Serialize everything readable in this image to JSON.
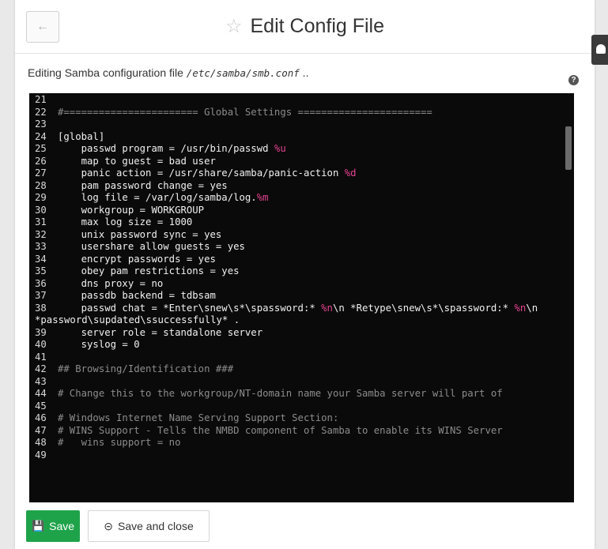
{
  "header": {
    "title": "Edit Config File"
  },
  "description": {
    "prefix": "Editing Samba configuration file ",
    "path": "/etc/samba/smb.conf",
    "suffix": " .."
  },
  "help": "?",
  "editor": {
    "lines": [
      {
        "n": "21",
        "parts": []
      },
      {
        "n": "22",
        "cmt": true,
        "parts": [
          {
            "t": "#======================= Global Settings ======================="
          }
        ]
      },
      {
        "n": "23",
        "parts": []
      },
      {
        "n": "24",
        "parts": [
          {
            "t": "[global]"
          }
        ]
      },
      {
        "n": "25",
        "parts": [
          {
            "t": "    passwd program = /usr/bin/passwd "
          },
          {
            "t": "%u",
            "m": true
          }
        ]
      },
      {
        "n": "26",
        "parts": [
          {
            "t": "    map to guest = bad user"
          }
        ]
      },
      {
        "n": "27",
        "parts": [
          {
            "t": "    panic action = /usr/share/samba/panic-action "
          },
          {
            "t": "%d",
            "m": true
          }
        ]
      },
      {
        "n": "28",
        "parts": [
          {
            "t": "    pam password change = yes"
          }
        ]
      },
      {
        "n": "29",
        "parts": [
          {
            "t": "    log file = /var/log/samba/log."
          },
          {
            "t": "%m",
            "m": true
          }
        ]
      },
      {
        "n": "30",
        "parts": [
          {
            "t": "    workgroup = WORKGROUP"
          }
        ]
      },
      {
        "n": "31",
        "parts": [
          {
            "t": "    max log size = 1000"
          }
        ]
      },
      {
        "n": "32",
        "parts": [
          {
            "t": "    unix password sync = yes"
          }
        ]
      },
      {
        "n": "33",
        "parts": [
          {
            "t": "    usershare allow guests = yes"
          }
        ]
      },
      {
        "n": "34",
        "parts": [
          {
            "t": "    encrypt passwords = yes"
          }
        ]
      },
      {
        "n": "35",
        "parts": [
          {
            "t": "    obey pam restrictions = yes"
          }
        ]
      },
      {
        "n": "36",
        "parts": [
          {
            "t": "    dns proxy = no"
          }
        ]
      },
      {
        "n": "37",
        "parts": [
          {
            "t": "    passdb backend = tdbsam"
          }
        ]
      },
      {
        "n": "38",
        "parts": [
          {
            "t": "    passwd chat = *Enter\\snew\\s*\\spassword:* "
          },
          {
            "t": "%n",
            "m": true
          },
          {
            "t": "\\n *Retype\\snew\\s*\\spassword:* "
          },
          {
            "t": "%n",
            "m": true
          },
          {
            "t": "\\n"
          }
        ]
      },
      {
        "n": "",
        "parts": [
          {
            "t": "*password\\supdated\\ssuccessfully* ."
          }
        ]
      },
      {
        "n": "39",
        "parts": [
          {
            "t": "    server role = standalone server"
          }
        ]
      },
      {
        "n": "40",
        "parts": [
          {
            "t": "    syslog = 0"
          }
        ]
      },
      {
        "n": "41",
        "parts": []
      },
      {
        "n": "42",
        "cmt": true,
        "parts": [
          {
            "t": "## Browsing/Identification ###"
          }
        ]
      },
      {
        "n": "43",
        "parts": []
      },
      {
        "n": "44",
        "cmt": true,
        "parts": [
          {
            "t": "# Change this to the workgroup/NT-domain name your Samba server will part of"
          }
        ]
      },
      {
        "n": "45",
        "parts": []
      },
      {
        "n": "46",
        "cmt": true,
        "parts": [
          {
            "t": "# Windows Internet Name Serving Support Section:"
          }
        ]
      },
      {
        "n": "47",
        "cmt": true,
        "parts": [
          {
            "t": "# WINS Support - Tells the NMBD component of Samba to enable its WINS Server"
          }
        ]
      },
      {
        "n": "48",
        "cmt": true,
        "parts": [
          {
            "t": "#   wins support = no"
          }
        ]
      },
      {
        "n": "49",
        "parts": []
      }
    ]
  },
  "footer": {
    "save_label": "Save",
    "save_close_label": "Save and close"
  },
  "icons": {
    "back": "arrow-left-icon",
    "star": "star-icon",
    "save": "floppy-disk-icon",
    "save_close": "circle-arrow-icon",
    "help": "question-icon"
  },
  "colors": {
    "save_button": "#1fa34a",
    "editor_bg": "#0a0a0a",
    "macro": "#e2418e",
    "comment": "#8c8c8c"
  }
}
